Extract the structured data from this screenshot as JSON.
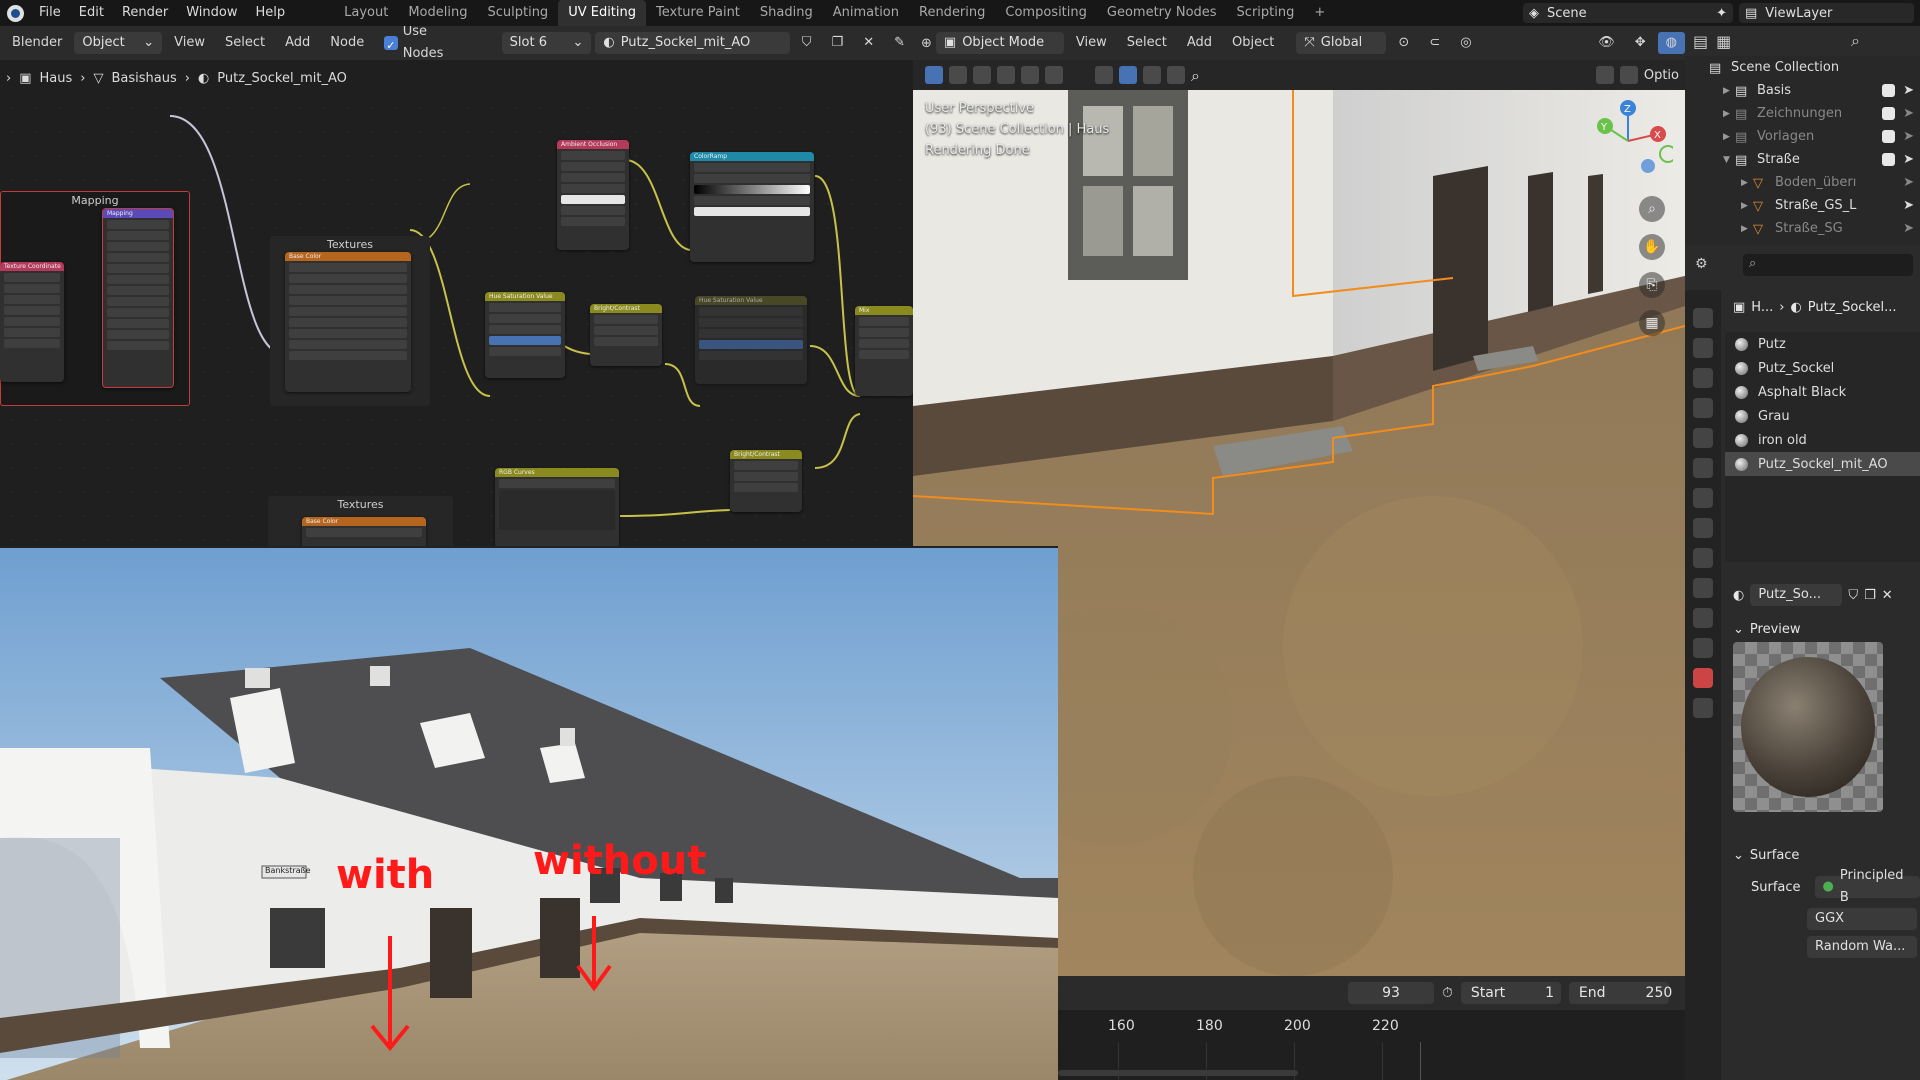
{
  "top_menu": {
    "app_menus": [
      "File",
      "Edit",
      "Render",
      "Window",
      "Help"
    ]
  },
  "workspaces": [
    "Layout",
    "Modeling",
    "Sculpting",
    "UV Editing",
    "Texture Paint",
    "Shading",
    "Animation",
    "Rendering",
    "Compositing",
    "Geometry Nodes",
    "Scripting"
  ],
  "active_workspace": "UV Editing",
  "scene": {
    "name": "Scene",
    "view_layer": "ViewLayer"
  },
  "node_editor": {
    "app_label": "Blender",
    "object_mode": "Object",
    "menus": [
      "View",
      "Select",
      "Add",
      "Node"
    ],
    "use_nodes_label": "Use Nodes",
    "slot": "Slot 6",
    "material_name": "Putz_Sockel_mit_AO",
    "breadcrumb": [
      "Haus",
      "Basishaus",
      "Putz_Sockel_mit_AO"
    ],
    "frames": {
      "mapping": "Mapping",
      "textures": "Textures",
      "textures2": "Textures"
    },
    "nodes": {
      "texture_coordinate": "Texture Coordinate",
      "mapping": "Mapping",
      "base_color": "Base Color",
      "base_color_2": "Base Color",
      "ambient_occlusion": "Ambient Occlusion",
      "color_ramp": "ColorRamp",
      "hue_sat_1": "Hue Saturation Value",
      "bright_contrast_1": "Bright/Contrast",
      "hue_sat_2": "Hue Saturation Value",
      "mix": "Mix",
      "rgb_curves": "RGB Curves",
      "bright_contrast_2": "Bright/Contrast"
    }
  },
  "viewport": {
    "mode": "Object Mode",
    "menus": [
      "View",
      "Select",
      "Add",
      "Object"
    ],
    "orientation": "Global",
    "options_label": "Optio",
    "overlay_lines": [
      "User Perspective",
      "(93) Scene Collection | Haus",
      "Rendering Done"
    ]
  },
  "outliner": {
    "title": "Scene Collection",
    "items": [
      {
        "label": "Basis",
        "dim": false
      },
      {
        "label": "Zeichnungen",
        "dim": true
      },
      {
        "label": "Vorlagen",
        "dim": true
      },
      {
        "label": "Straße",
        "dim": false
      },
      {
        "label": "Boden_überı",
        "dim": true
      },
      {
        "label": "Straße_GS_L",
        "dim": false
      },
      {
        "label": "Straße_SG",
        "dim": true
      }
    ]
  },
  "properties": {
    "breadcrumb": [
      "H...",
      "Putz_Sockel..."
    ],
    "materials": [
      "Putz",
      "Putz_Sockel",
      "Asphalt Black",
      "Grau",
      "iron old",
      "Putz_Sockel_mit_AO"
    ],
    "active_material": "Putz_So...",
    "preview_label": "Preview",
    "surface_panel": "Surface",
    "surface_label": "Surface",
    "surface_value": "Principled B",
    "distribution": "GGX",
    "subsurface": "Random Wa..."
  },
  "timeline": {
    "current_frame": "93",
    "start_label": "Start",
    "start": "1",
    "end_label": "End",
    "end": "250",
    "ruler": [
      "160",
      "180",
      "200",
      "220"
    ]
  },
  "render_annotations": {
    "with": "with",
    "without": "without",
    "street_sign": "Bankstraße"
  },
  "colors": {
    "accent": "#4772b3",
    "selection_outline": "#f28c1c",
    "annotation_red": "#ff1a1a"
  }
}
